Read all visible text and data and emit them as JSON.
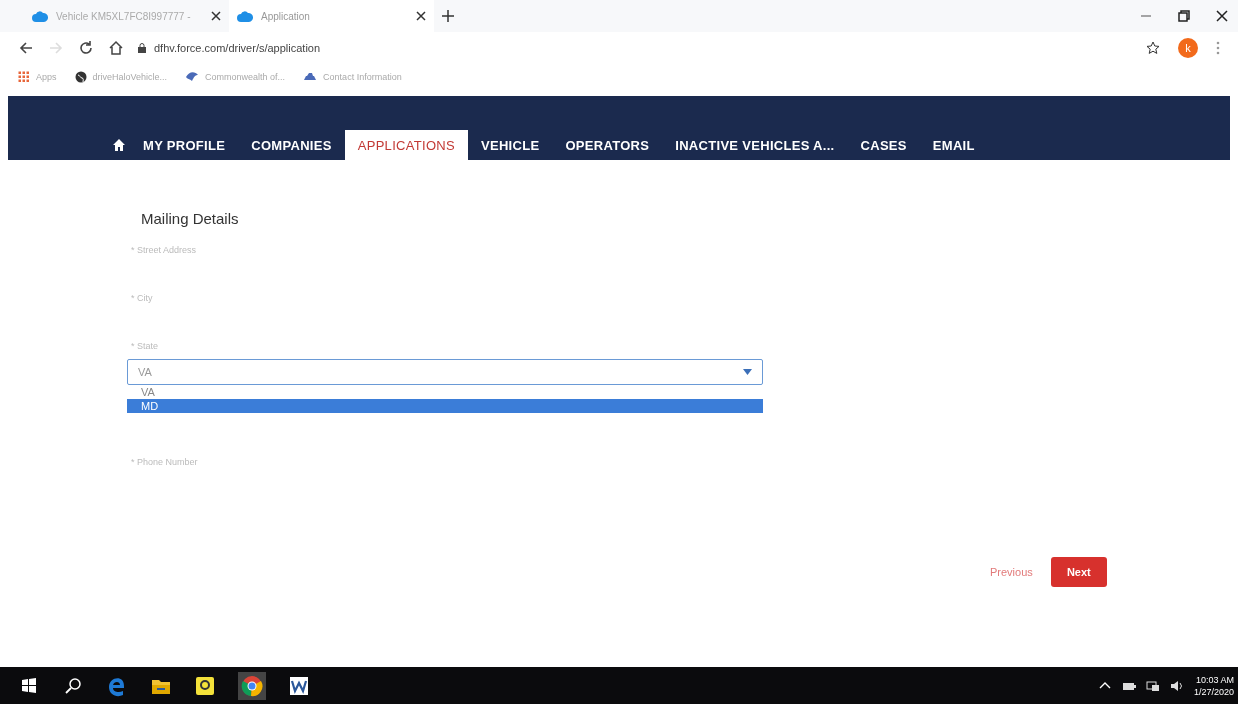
{
  "browser": {
    "tabs": [
      {
        "title": "Vehicle KM5XL7FC8I997777 -",
        "selected": false
      },
      {
        "title": "Application",
        "selected": true
      }
    ],
    "url": "dfhv.force.com/driver/s/application",
    "profile_initial": "k",
    "bookmarks": [
      "Apps",
      "driveHaloVehicle...",
      "Commonwealth of...",
      "Contact Information"
    ]
  },
  "nav": {
    "items": [
      {
        "label": "MY PROFILE",
        "selected": false
      },
      {
        "label": "COMPANIES",
        "selected": false
      },
      {
        "label": "APPLICATIONS",
        "selected": true
      },
      {
        "label": "VEHICLE",
        "selected": false
      },
      {
        "label": "OPERATORS",
        "selected": false
      },
      {
        "label": "INACTIVE VEHICLES A...",
        "selected": false
      },
      {
        "label": "CASES",
        "selected": false
      },
      {
        "label": "EMAIL",
        "selected": false
      }
    ]
  },
  "form": {
    "title": "Mailing Details",
    "fields": [
      {
        "kind": "text",
        "label": "* Street Address"
      },
      {
        "kind": "text",
        "label": "* City"
      },
      {
        "kind": "select",
        "label": "* State",
        "value": "VA",
        "options": [
          {
            "label": "VA",
            "highlighted": false
          },
          {
            "label": "MD",
            "highlighted": true
          }
        ]
      },
      {
        "kind": "text",
        "label": "* Phone Number"
      }
    ],
    "previous": "Previous",
    "next": "Next"
  },
  "taskbar": {
    "time": "10:03 AM",
    "date": "1/27/2020"
  }
}
